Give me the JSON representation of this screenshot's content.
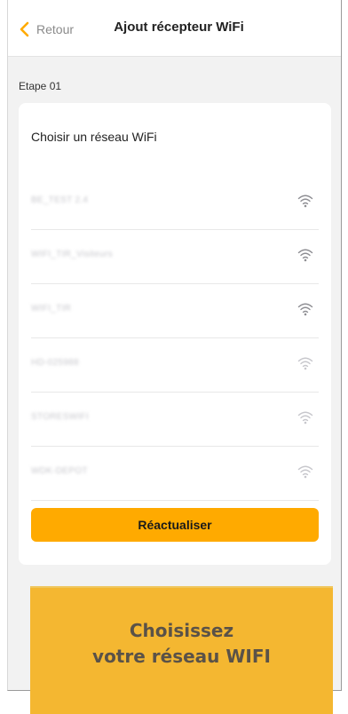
{
  "header": {
    "back_label": "Retour",
    "title": "Ajout récepteur WiFi"
  },
  "step_label": "Etape 01",
  "card": {
    "title": "Choisir un réseau WiFi",
    "networks": [
      {
        "ssid": "BE_TEST 2.4",
        "signal": "strong"
      },
      {
        "ssid": "WIFI_TIR_Visiteurs",
        "signal": "strong"
      },
      {
        "ssid": "WIFI_TIR",
        "signal": "strong"
      },
      {
        "ssid": "HD-025988",
        "signal": "weak"
      },
      {
        "ssid": "STORESWIFI",
        "signal": "weak"
      },
      {
        "ssid": "WDK-DEPOT",
        "signal": "weak"
      }
    ],
    "refresh_label": "Réactualiser"
  },
  "banner": {
    "line1": "Choisissez",
    "line2": "votre réseau WIFI"
  },
  "colors": {
    "accent": "#ffaa00",
    "banner": "#f4b731",
    "wifi_strong": "#8e8e93",
    "wifi_weak": "#c7c7cc"
  }
}
